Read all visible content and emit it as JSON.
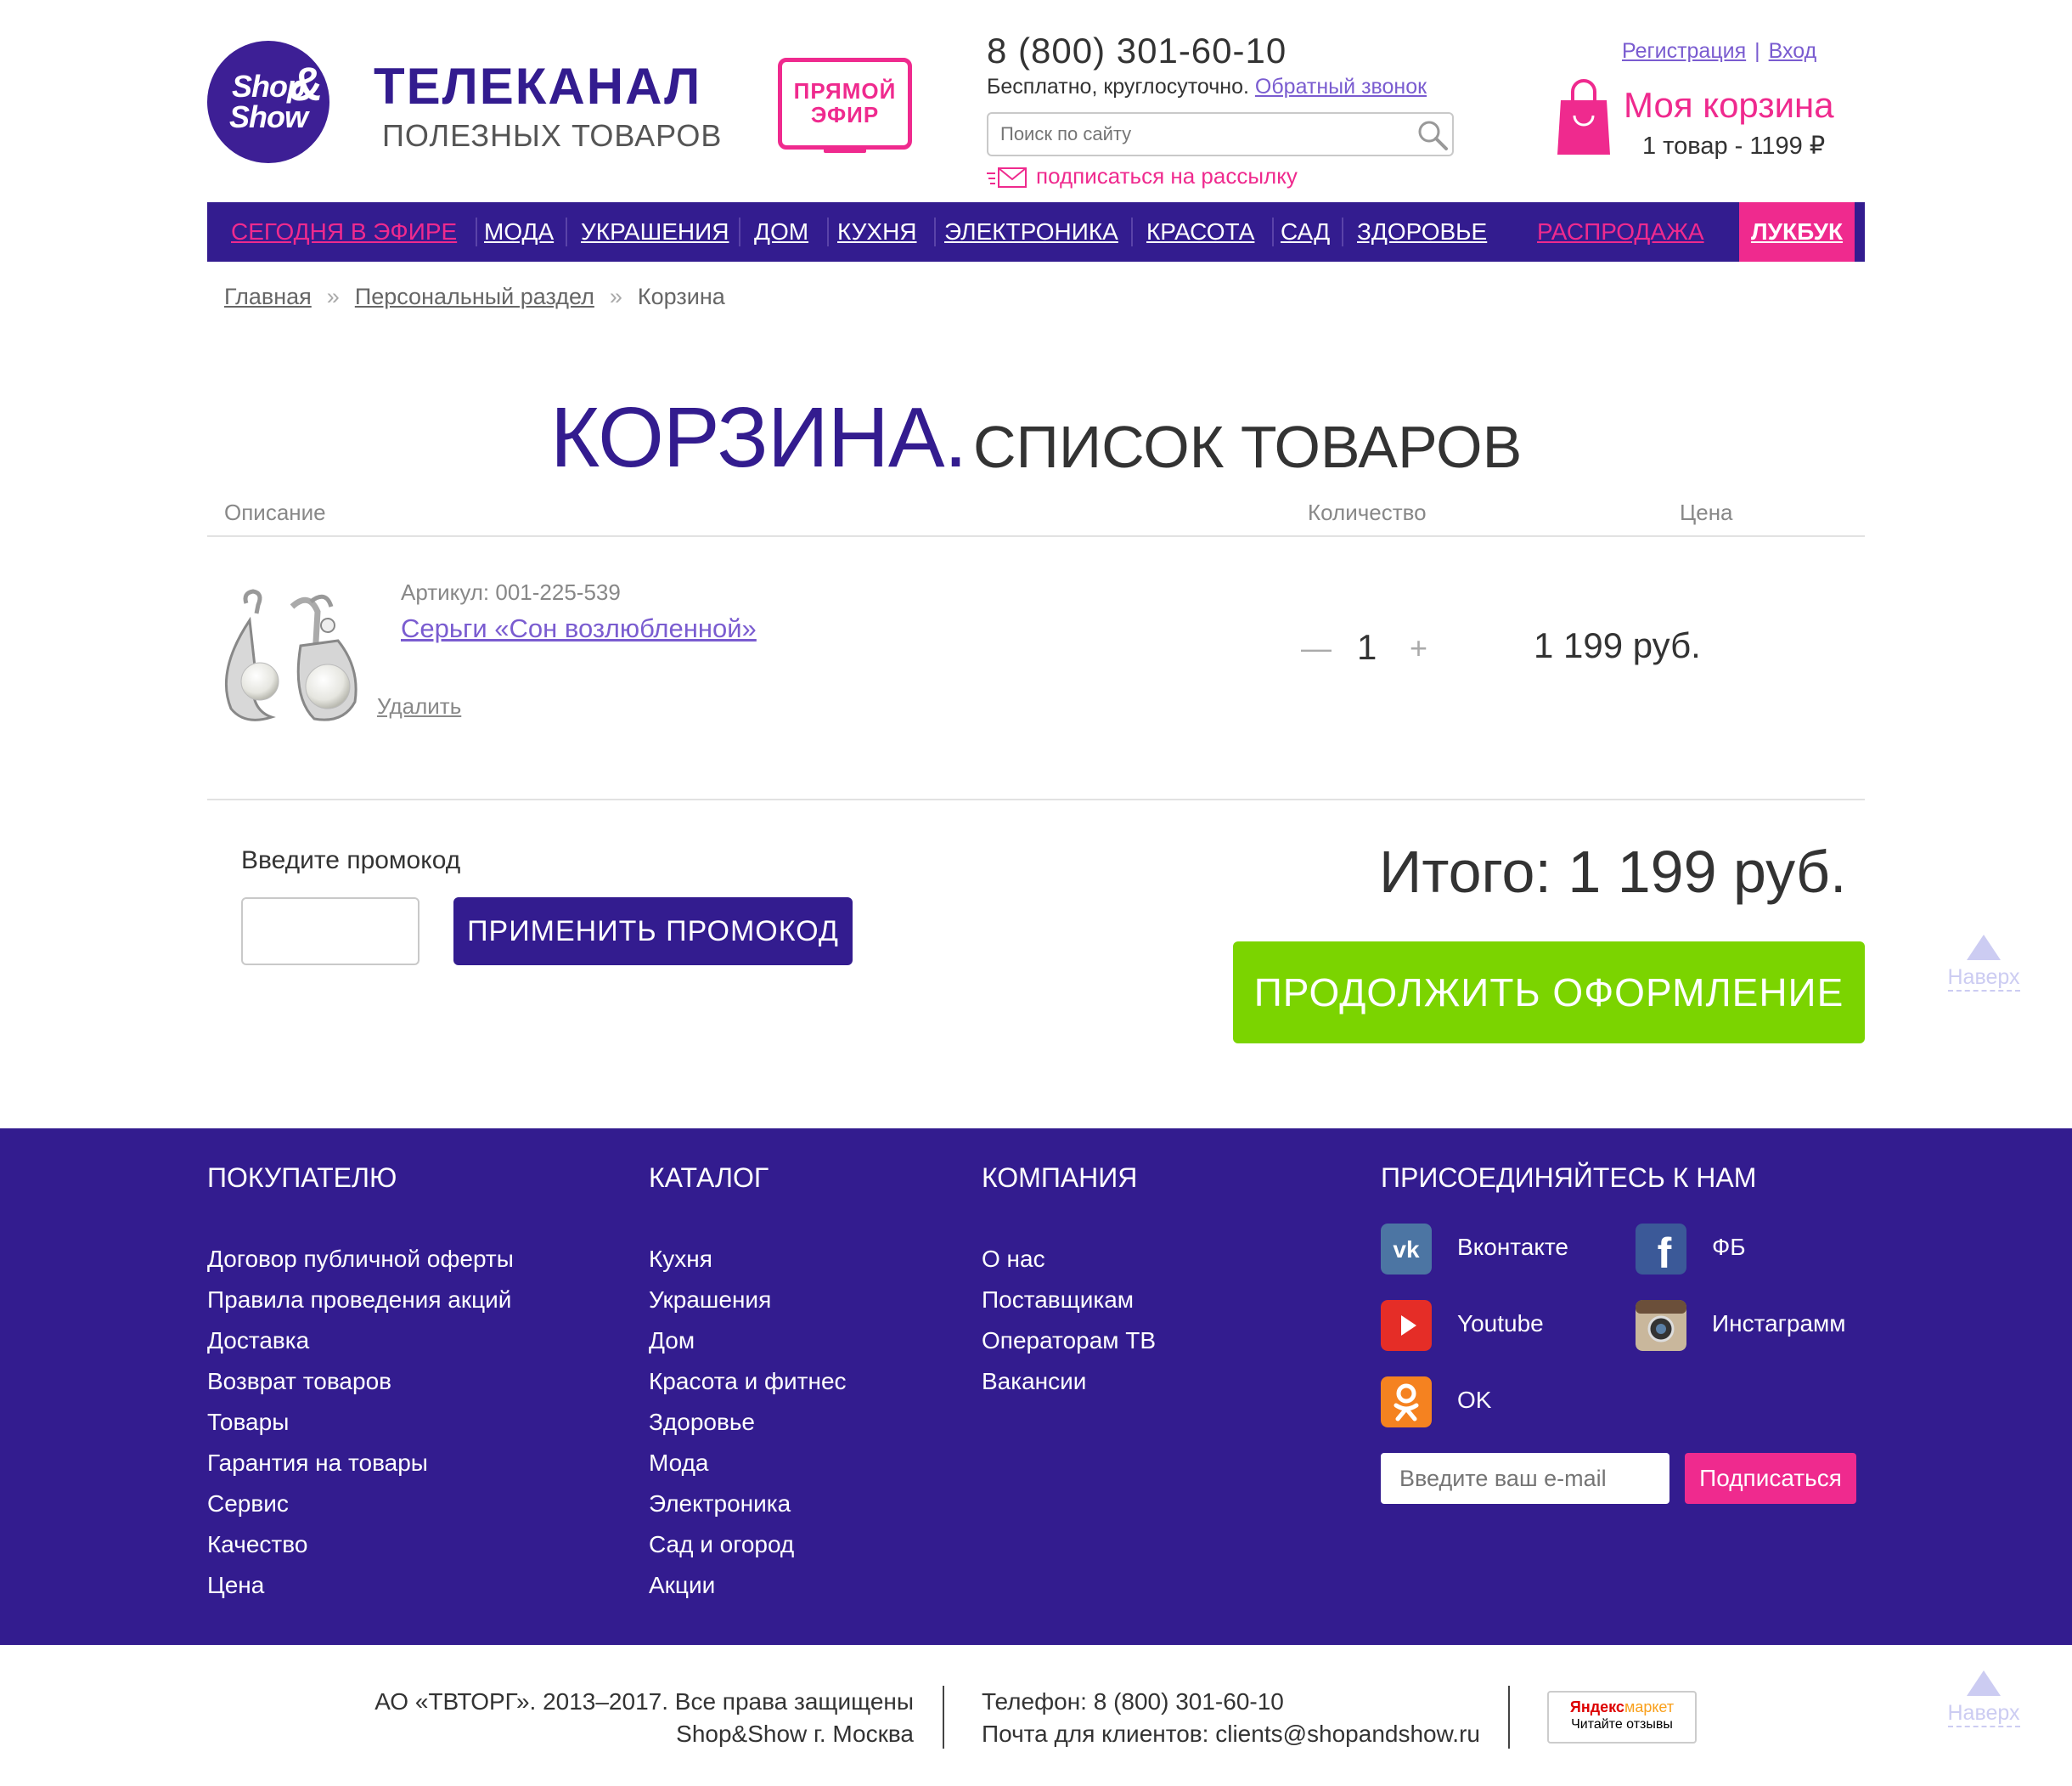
{
  "header": {
    "logo_text": "Shop&Show",
    "brand_line1": "ТЕЛЕКАНАЛ",
    "brand_line2": "ПОЛЕЗНЫХ ТОВАРОВ",
    "live_label": "ПРЯМОЙ ЭФИР",
    "phone": "8 (800) 301-60-10",
    "phone_note": "Бесплатно, круглосуточно.",
    "callback_link": "Обратный звонок",
    "search_placeholder": "Поиск по сайту",
    "subscribe_link": "подписаться на рассылку",
    "register_link": "Регистрация",
    "login_link": "Вход",
    "cart_title": "Моя корзина",
    "cart_summary": "1 товар - 1199 ₽"
  },
  "nav": {
    "items": [
      "СЕГОДНЯ В ЭФИРЕ",
      "МОДА",
      "УКРАШЕНИЯ",
      "ДОМ",
      "КУХНЯ",
      "ЭЛЕКТРОНИКА",
      "КРАСОТА",
      "САД",
      "ЗДОРОВЬЕ",
      "РАСПРОДАЖА",
      "ЛУКБУК"
    ]
  },
  "breadcrumbs": [
    "Главная",
    "Персональный раздел",
    "Корзина"
  ],
  "cart": {
    "title_main": "КОРЗИНА.",
    "title_sub": "СПИСОК ТОВАРОВ",
    "col_description": "Описание",
    "col_quantity": "Количество",
    "col_price": "Цена",
    "item": {
      "sku": "Артикул: 001-225-539",
      "name": "Серьги «Сон возлюбленной»",
      "delete": "Удалить",
      "quantity": "1",
      "price": "1 199 руб."
    },
    "promo_label": "Введите промокод",
    "promo_button": "ПРИМЕНИТЬ ПРОМОКОД",
    "total": "Итого: 1 199 руб.",
    "checkout_button": "ПРОДОЛЖИТЬ ОФОРМЛЕНИЕ"
  },
  "to_top": "Наверх",
  "footer": {
    "col1": {
      "title": "ПОКУПАТЕЛЮ",
      "items": [
        "Договор публичной оферты",
        "Правила проведения акций",
        "Доставка",
        "Возврат товаров",
        "Товары",
        "Гарантия на товары",
        "Сервис",
        "Качество",
        "Цена"
      ]
    },
    "col2": {
      "title": "КАТАЛОГ",
      "items": [
        "Кухня",
        "Украшения",
        "Дом",
        "Красота и фитнес",
        "Здоровье",
        "Мода",
        "Электроника",
        "Сад и огород",
        "Акции"
      ]
    },
    "col3": {
      "title": "КОМПАНИЯ",
      "items": [
        "О нас",
        "Поставщикам",
        "Операторам ТВ",
        "Вакансии"
      ]
    },
    "social": {
      "title": "ПРИСОЕДИНЯЙТЕСЬ К НАМ",
      "vk": "Вконтакте",
      "fb": "ФБ",
      "youtube": "Youtube",
      "instagram": "Инстаграмм",
      "ok": "OK",
      "email_placeholder": "Введите ваш e-mail",
      "subscribe_button": "Подписаться"
    }
  },
  "bottom": {
    "copyright": "АО «ТВТОРГ». 2013–2017. Все права защищены",
    "city": "Shop&Show г. Москва",
    "phone": "Телефон: 8 (800) 301-60-10",
    "email": "Почта для клиентов: clients@shopandshow.ru",
    "ym_line1a": "Яндекс",
    "ym_line1b": "маркет",
    "ym_line2": "Читайте отзывы"
  },
  "colors": {
    "primary": "#331c8f",
    "accent": "#ef2a8e",
    "checkout": "#7bd400",
    "link": "#7a5cd0"
  }
}
